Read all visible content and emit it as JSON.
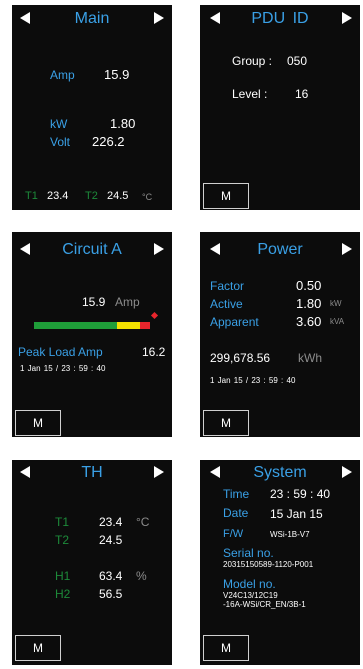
{
  "nav_icons": {
    "prev": "left-triangle",
    "next": "right-triangle"
  },
  "colors": {
    "label_blue": "#3aa0e6",
    "label_green": "#1d8a3a",
    "bar_green": "#1f9e39",
    "bar_yellow": "#f3e100",
    "bar_red": "#e8252c"
  },
  "main": {
    "title": "Main",
    "amp_label": "Amp",
    "amp_value": "15.9",
    "kw_label": "kW",
    "kw_value": "1.80",
    "volt_label": "Volt",
    "volt_value": "226.2",
    "t1_label": "T1",
    "t1_value": "23.4",
    "t2_label": "T2",
    "t2_value": "24.5",
    "temp_unit": "°C"
  },
  "pdu": {
    "title": "PDU ID",
    "group_label": "Group :",
    "group_value": "050",
    "level_label": "Level :",
    "level_value": "16",
    "m_button": "M"
  },
  "circuit": {
    "title": "Circuit A",
    "amp_value": "15.9",
    "amp_unit": "Amp",
    "load_fraction": 0.98,
    "peak_label": "Peak Load Amp",
    "peak_value": "16.2",
    "timestamp": "1 Jan 15 / 23 : 59 : 40",
    "m_button": "M"
  },
  "power": {
    "title": "Power",
    "factor_label": "Factor",
    "factor_value": "0.50",
    "active_label": "Active",
    "active_value": "1.80",
    "active_unit": "kW",
    "apparent_label": "Apparent",
    "apparent_value": "3.60",
    "apparent_unit": "kVA",
    "energy_value": "299,678.56",
    "energy_unit": "kWh",
    "timestamp": "1 Jan 15 / 23 : 59 : 40",
    "m_button": "M"
  },
  "th": {
    "title": "TH",
    "t1_label": "T1",
    "t1_value": "23.4",
    "t2_label": "T2",
    "t2_value": "24.5",
    "temp_unit": "°C",
    "h1_label": "H1",
    "h1_value": "63.4",
    "h2_label": "H2",
    "h2_value": "56.5",
    "hum_unit": "%",
    "m_button": "M"
  },
  "system": {
    "title": "System",
    "time_label": "Time",
    "time_value": "23 : 59 : 40",
    "date_label": "Date",
    "date_value": "15 Jan 15",
    "fw_label": "F/W",
    "fw_value": "WSi-1B-V7",
    "serial_label": "Serial no.",
    "serial_value": "20315150589-1120-P001",
    "model_label": "Model no.",
    "model_line1": "V24C13/12C19",
    "model_line2": "-16A-WSi/CR_EN/3B-1",
    "m_button": "M"
  }
}
